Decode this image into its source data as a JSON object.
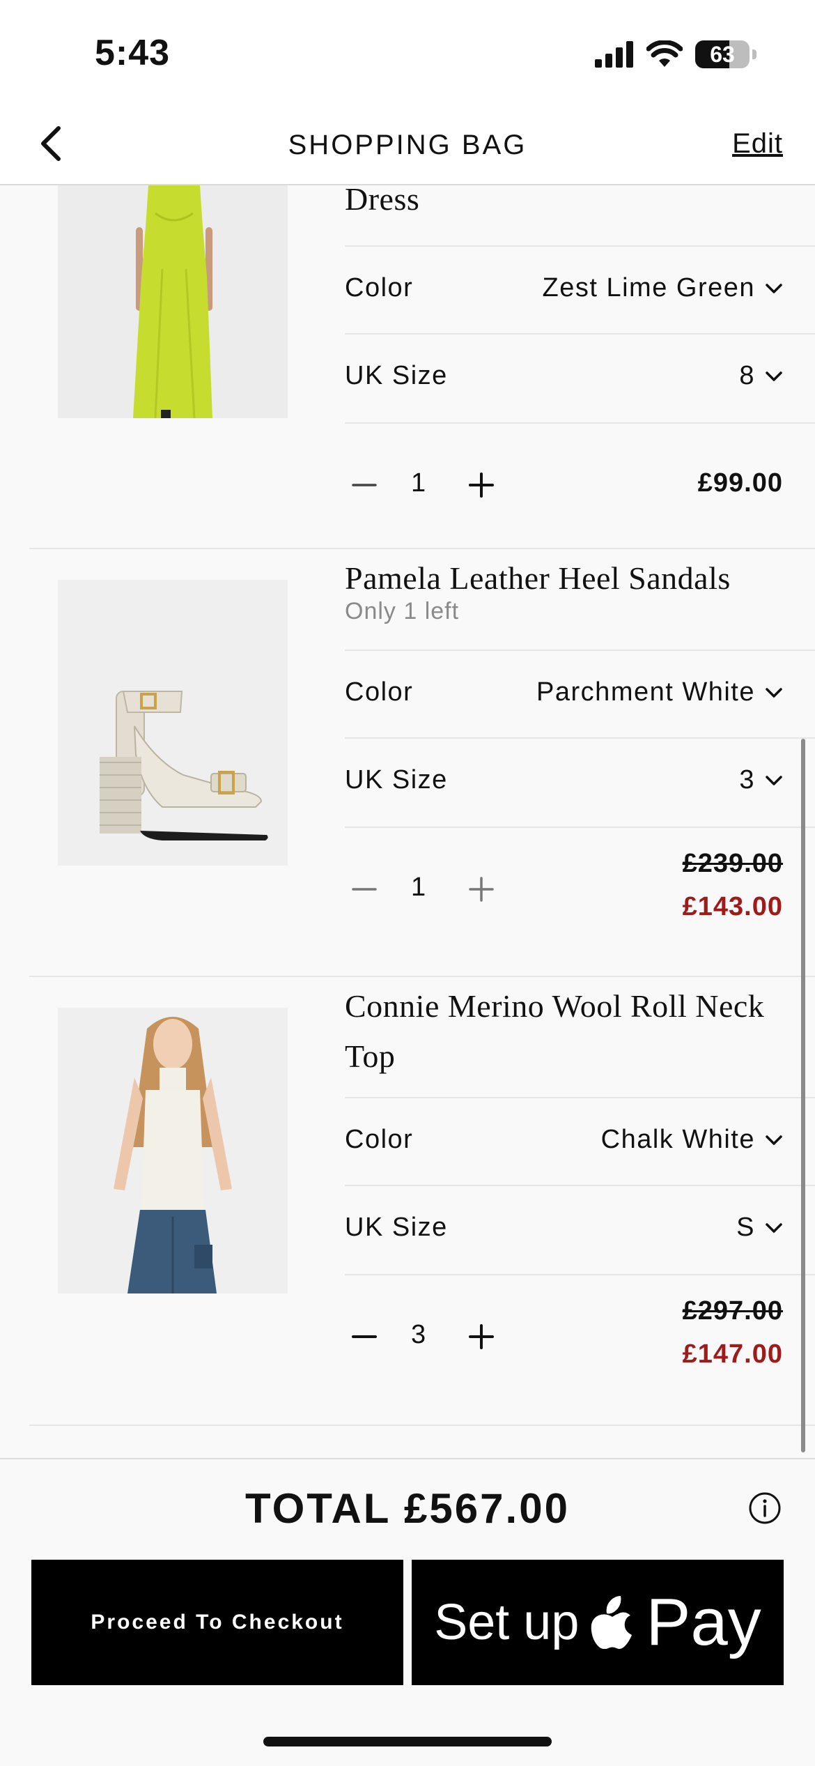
{
  "status_bar": {
    "time": "5:43",
    "battery": "63",
    "battery_level": 0.63
  },
  "header": {
    "title": "SHOPPING BAG",
    "edit": "Edit"
  },
  "items": [
    {
      "name": "Dress",
      "image_icon": "lime-slip-dress",
      "color_label": "Color",
      "color_value": "Zest Lime Green",
      "size_label": "UK Size",
      "size_value": "8",
      "quantity": "1",
      "price": "£99.00"
    },
    {
      "name": "Pamela Leather Heel Sandals",
      "stock": "Only 1 left",
      "image_icon": "white-heel-sandal",
      "color_label": "Color",
      "color_value": "Parchment White",
      "size_label": "UK Size",
      "size_value": "3",
      "quantity": "1",
      "original_price": "£239.00",
      "sale_price": "£143.00"
    },
    {
      "name": "Connie Merino Wool Roll Neck Top",
      "image_icon": "white-roll-neck-top",
      "color_label": "Color",
      "color_value": "Chalk White",
      "size_label": "UK Size",
      "size_value": "S",
      "quantity": "3",
      "original_price": "£297.00",
      "sale_price": "£147.00"
    }
  ],
  "footer": {
    "total": "TOTAL £567.00",
    "checkout": "Proceed To Checkout",
    "applepay_setup": "Set up",
    "applepay_pay": "Pay"
  },
  "colors": {
    "sale": "#9e1b1b",
    "button": "#000000",
    "background": "#f9f9f9"
  }
}
